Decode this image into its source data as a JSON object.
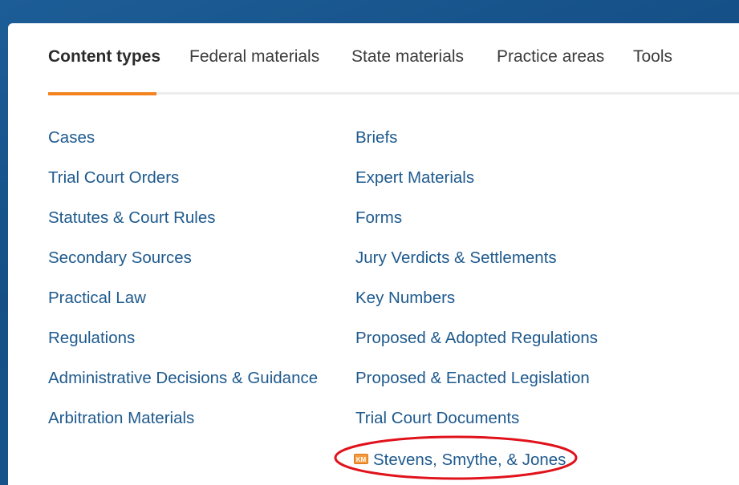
{
  "tabs": [
    {
      "label": "Content types",
      "active": true
    },
    {
      "label": "Federal materials",
      "active": false
    },
    {
      "label": "State materials",
      "active": false
    },
    {
      "label": "Practice areas",
      "active": false
    },
    {
      "label": "Tools",
      "active": false
    }
  ],
  "left_column": [
    "Cases",
    "Trial Court Orders",
    "Statutes & Court Rules",
    "Secondary Sources",
    "Practical Law",
    "Regulations",
    "Administrative Decisions & Guidance",
    "Arbitration Materials"
  ],
  "right_column": [
    "Briefs",
    "Expert Materials",
    "Forms",
    "Jury Verdicts & Settlements",
    "Key Numbers",
    "Proposed & Adopted Regulations",
    "Proposed & Enacted Legislation",
    "Trial Court Documents"
  ],
  "km_item": {
    "icon_text": "KM",
    "label": "Stevens, Smythe, & Jones"
  },
  "colors": {
    "accent": "#f3821f",
    "link": "#1e5a8e",
    "annotation": "#e0121b",
    "background": "#1a5a92"
  }
}
